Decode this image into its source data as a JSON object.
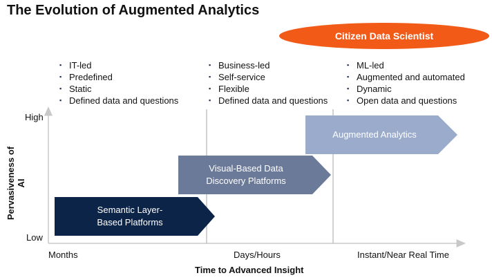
{
  "title": "The Evolution of Augmented Analytics",
  "oval_label": "Citizen Data Scientist",
  "columns": [
    {
      "bullets": [
        "IT-led",
        "Predefined",
        "Static",
        "Defined data and questions"
      ]
    },
    {
      "bullets": [
        "Business-led",
        "Self-service",
        "Flexible",
        "Defined data and questions"
      ]
    },
    {
      "bullets": [
        "ML-led",
        "Augmented and automated",
        "Dynamic",
        "Open data and questions"
      ]
    }
  ],
  "stages": [
    {
      "label": "Semantic Layer-\nBased Platforms",
      "color": "#0d2449"
    },
    {
      "label": "Visual-Based Data\nDiscovery Platforms",
      "color": "#6b7a99"
    },
    {
      "label": "Augmented Analytics",
      "color": "#9aabcb"
    }
  ],
  "y_axis": {
    "label": "Pervasiveness of AI",
    "high": "High",
    "low": "Low"
  },
  "x_axis": {
    "label": "Time to Advanced Insight",
    "ticks": [
      "Months",
      "Days/Hours",
      "Instant/Near Real Time"
    ]
  }
}
